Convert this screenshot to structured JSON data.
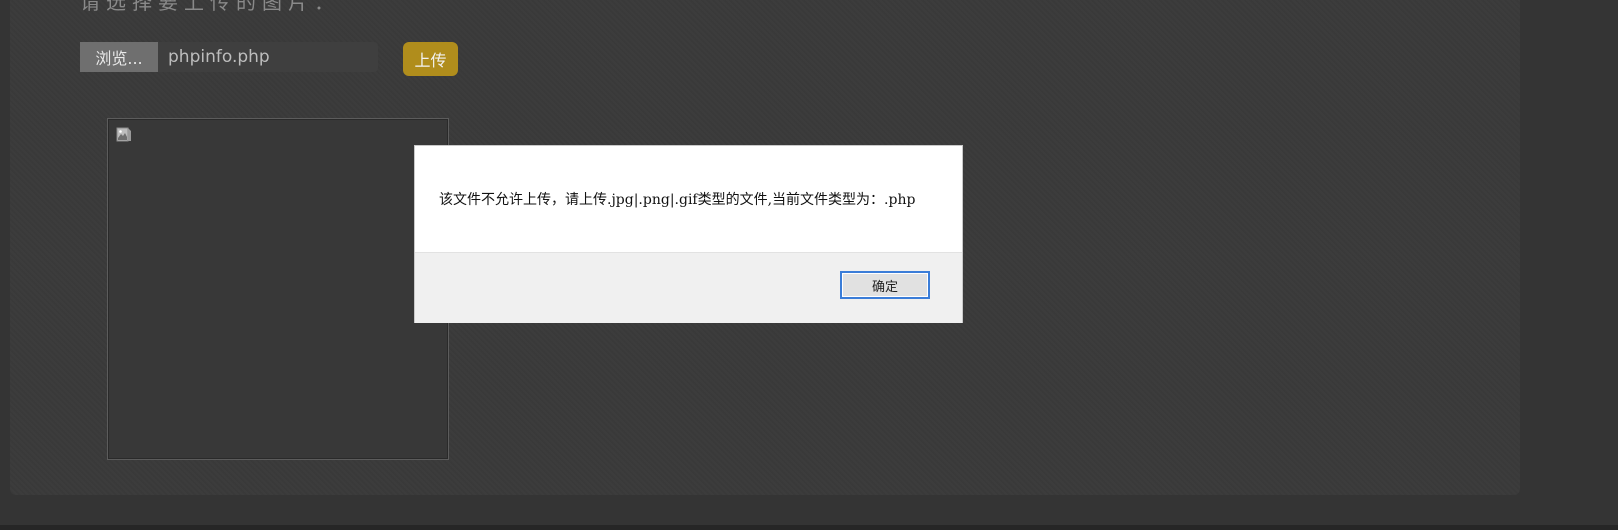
{
  "upload": {
    "title": "请选择要上传的图片：",
    "browse_label": "浏览...",
    "filename": "phpinfo.php",
    "upload_label": "上传"
  },
  "preview": {
    "icon": "broken-image-icon"
  },
  "alert": {
    "message": "该文件不允许上传，请上传.jpg|.png|.gif类型的文件,当前文件类型为：.php",
    "ok_label": "确定"
  },
  "colors": {
    "upload_button": "#b08d1c",
    "dialog_button_border": "#3b7dd8"
  }
}
